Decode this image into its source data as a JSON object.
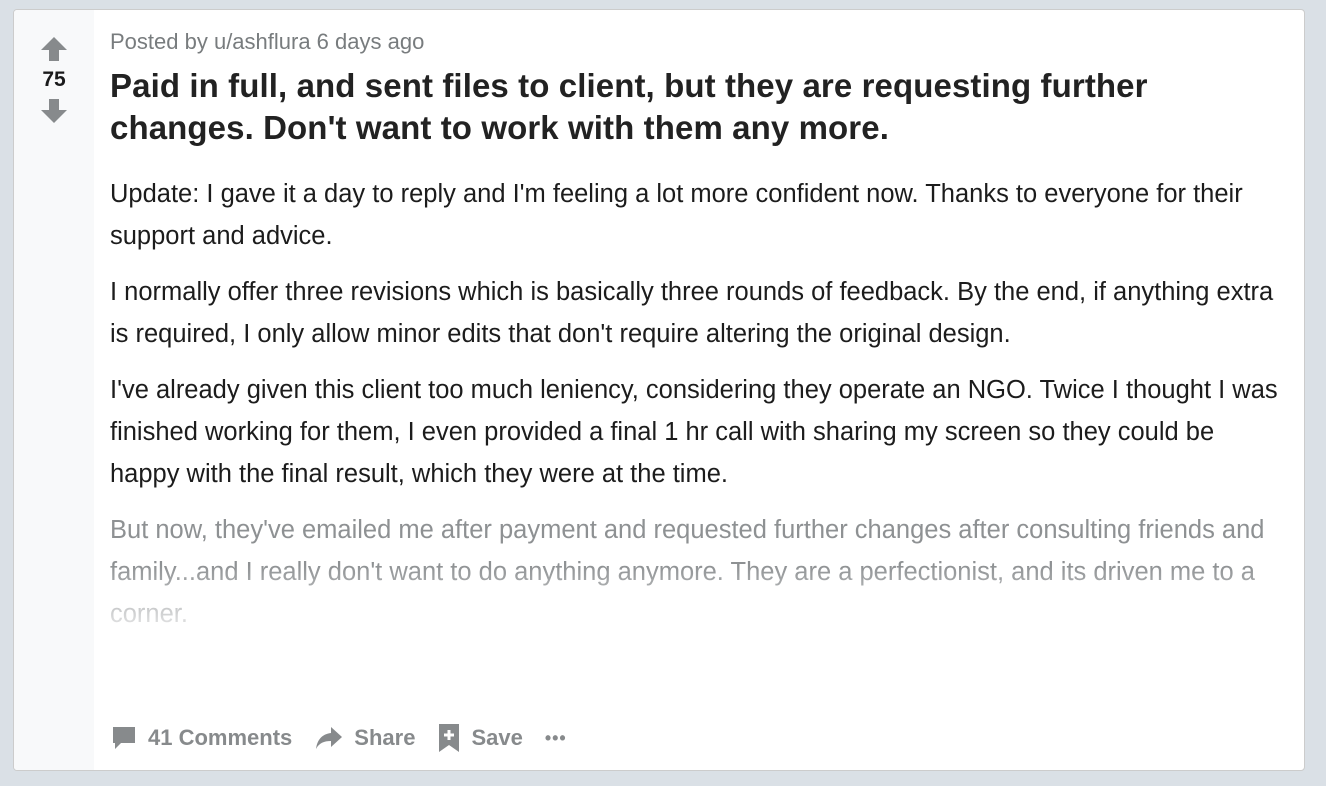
{
  "post": {
    "score": "75",
    "meta": "Posted by u/ashflura 6 days ago",
    "title": "Paid in full, and sent files to client, but they are requesting further changes. Don't want to work with them any more.",
    "paragraphs": [
      "Update: I gave it a day to reply and I'm feeling a lot more confident now. Thanks to everyone for their support and advice.",
      "I normally offer three revisions which is basically three rounds of feedback. By the end, if anything extra is required, I only allow minor edits that don't require altering the original design.",
      "I've already given this client too much leniency, considering they operate an NGO. Twice I thought I was finished working for them, I even provided a final 1 hr call with sharing my screen so they could be happy with the final result, which they were at the time.",
      "But now, they've emailed me after payment and requested further changes after consulting friends and family...and I really don't want to do anything anymore. They are a perfectionist, and its driven me to a corner."
    ]
  },
  "actions": {
    "comments_label": "41 Comments",
    "share_label": "Share",
    "save_label": "Save",
    "more_label": "•••"
  },
  "icons": {
    "upvote": "arrow-up-icon",
    "downvote": "arrow-down-icon",
    "comments": "comment-bubble-icon",
    "share": "share-arrow-icon",
    "save": "bookmark-plus-icon",
    "more": "ellipsis-icon"
  },
  "colors": {
    "page_bg": "#dae0e6",
    "card_bg": "#ffffff",
    "vote_rail_bg": "#f8f9fa",
    "icon_gray": "#878a8c",
    "title": "#222222",
    "meta": "#787c7e"
  }
}
